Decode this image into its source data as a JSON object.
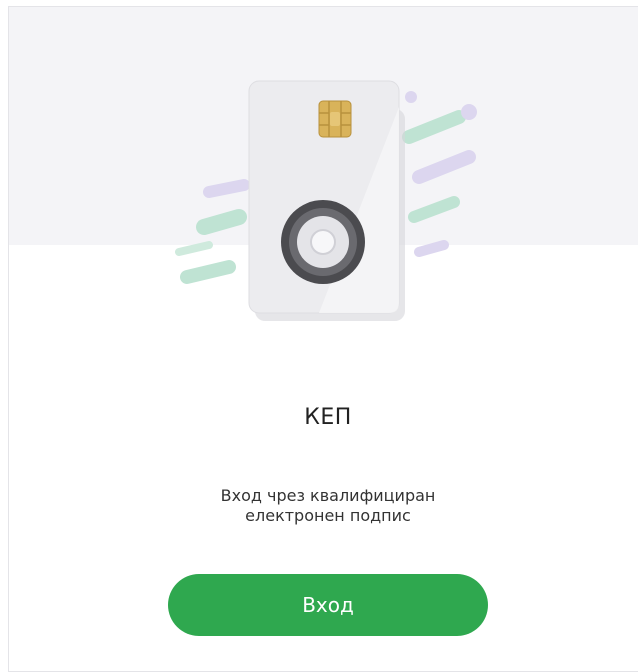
{
  "card": {
    "title": "КЕП",
    "description_line1": "Вход чрез квалифициран",
    "description_line2": "електронен подпис",
    "button_label": "Вход",
    "icon": "smart-card-icon"
  },
  "colors": {
    "button": "#2fa84f",
    "hero_background": "#f4f4f7",
    "streak_green": "#a9d8c6",
    "streak_purple": "#d6d1ec",
    "chip": "#d9b35a"
  }
}
